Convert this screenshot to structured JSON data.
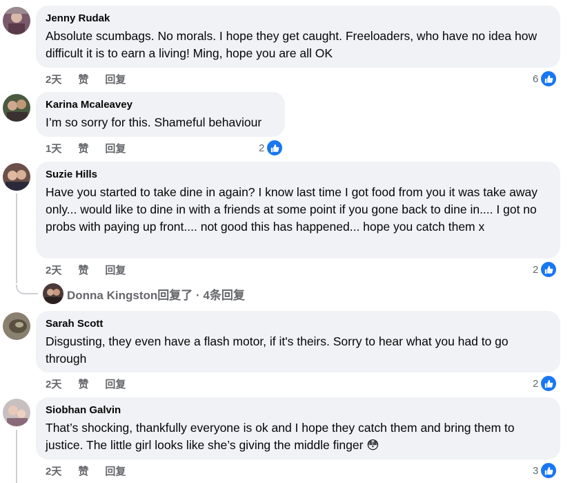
{
  "comments": [
    {
      "name": "Jenny Rudak",
      "text": "Absolute scumbags. No morals. I hope they get caught. Freeloaders, who have no idea how difficult it is to earn a living! Ming, hope you are all OK",
      "time": "2天",
      "like": "赞",
      "reply": "回复",
      "reactions": "6"
    },
    {
      "name": "Karina Mcaleavey",
      "text": "I’m so sorry for this. Shameful behaviour",
      "time": "1天",
      "like": "赞",
      "reply": "回复",
      "reactions": "2"
    },
    {
      "name": "Suzie Hills",
      "text": "Have you started to take dine in again? I know last time I got food from you it was take away only... would like to dine in with a friends at some point if you gone back to dine in.... I got no probs with paying up front.... not good this has happened... hope you catch them x",
      "time": "2天",
      "like": "赞",
      "reply": "回复",
      "reactions": "2"
    },
    {
      "name": "Sarah Scott",
      "text": "Disgusting, they even have a flash motor, if it's theirs. Sorry to hear what you had to go through",
      "time": "2天",
      "like": "赞",
      "reply": "回复",
      "reactions": "2"
    },
    {
      "name": "Siobhan Galvin",
      "text": "That’s shocking, thankfully everyone is ok and I hope they catch them and bring them to justice. The little girl looks like she’s giving the middle finger",
      "emoji": "😳",
      "time": "2天",
      "like": "赞",
      "reply": "回复",
      "reactions": "3"
    }
  ],
  "replies_summary": "Donna Kingston回复了 · 4条回复",
  "colors": {
    "bubble": "#f0f2f5",
    "like_blue": "#1877f2",
    "meta_gray": "#65676b"
  },
  "icons": {
    "like": "thumbs-up-icon"
  }
}
